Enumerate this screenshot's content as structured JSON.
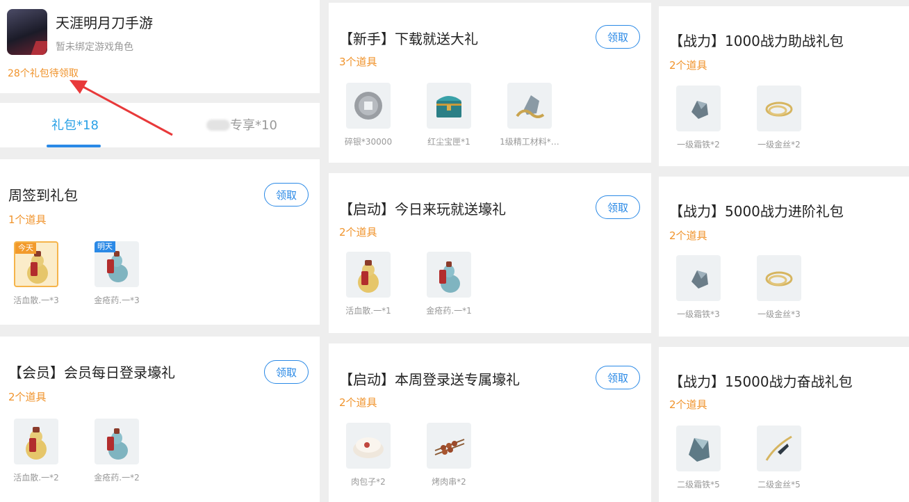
{
  "app": {
    "title": "天涯明月刀手游",
    "subtitle": "暂未绑定游戏角色",
    "pending": "28个礼包待领取"
  },
  "tabs": {
    "gift": "礼包*18",
    "exclusive": "专享*10"
  },
  "claim_label": "领取",
  "gifts": [
    {
      "title": "周签到礼包",
      "count": "1个道具",
      "items": [
        {
          "label": "活血散.一*3",
          "tag": "今天"
        },
        {
          "label": "金疮药.一*3",
          "tag": "明天"
        }
      ]
    },
    {
      "title": "【会员】会员每日登录壕礼",
      "count": "2个道具",
      "items": [
        {
          "label": "活血散.一*2"
        },
        {
          "label": "金疮药.一*2"
        }
      ]
    },
    {
      "title": "【新手】下载就送大礼",
      "count": "3个道具",
      "items": [
        {
          "label": "碎银*30000"
        },
        {
          "label": "红尘宝匣*1"
        },
        {
          "label": "1级精工材料*…"
        }
      ]
    },
    {
      "title": "【启动】今日来玩就送壕礼",
      "count": "2个道具",
      "items": [
        {
          "label": "活血散.一*1"
        },
        {
          "label": "金疮药.一*1"
        }
      ]
    },
    {
      "title": "【启动】本周登录送专属壕礼",
      "count": "2个道具",
      "items": [
        {
          "label": "肉包子*2"
        },
        {
          "label": "烤肉串*2"
        }
      ]
    },
    {
      "title": "【战力】1000战力助战礼包",
      "count": "2个道具",
      "items": [
        {
          "label": "一级霜铁*2"
        },
        {
          "label": "一级金丝*2"
        }
      ]
    },
    {
      "title": "【战力】5000战力进阶礼包",
      "count": "2个道具",
      "items": [
        {
          "label": "一级霜铁*3"
        },
        {
          "label": "一级金丝*3"
        }
      ]
    },
    {
      "title": "【战力】15000战力奋战礼包",
      "count": "2个道具",
      "items": [
        {
          "label": "二级霜铁*5"
        },
        {
          "label": "二级金丝*5"
        }
      ]
    }
  ],
  "colors": {
    "accent": "#2a89e6",
    "tab_active": "#2aa1e6",
    "orange": "#f0932b",
    "arrow": "#e8393a"
  }
}
